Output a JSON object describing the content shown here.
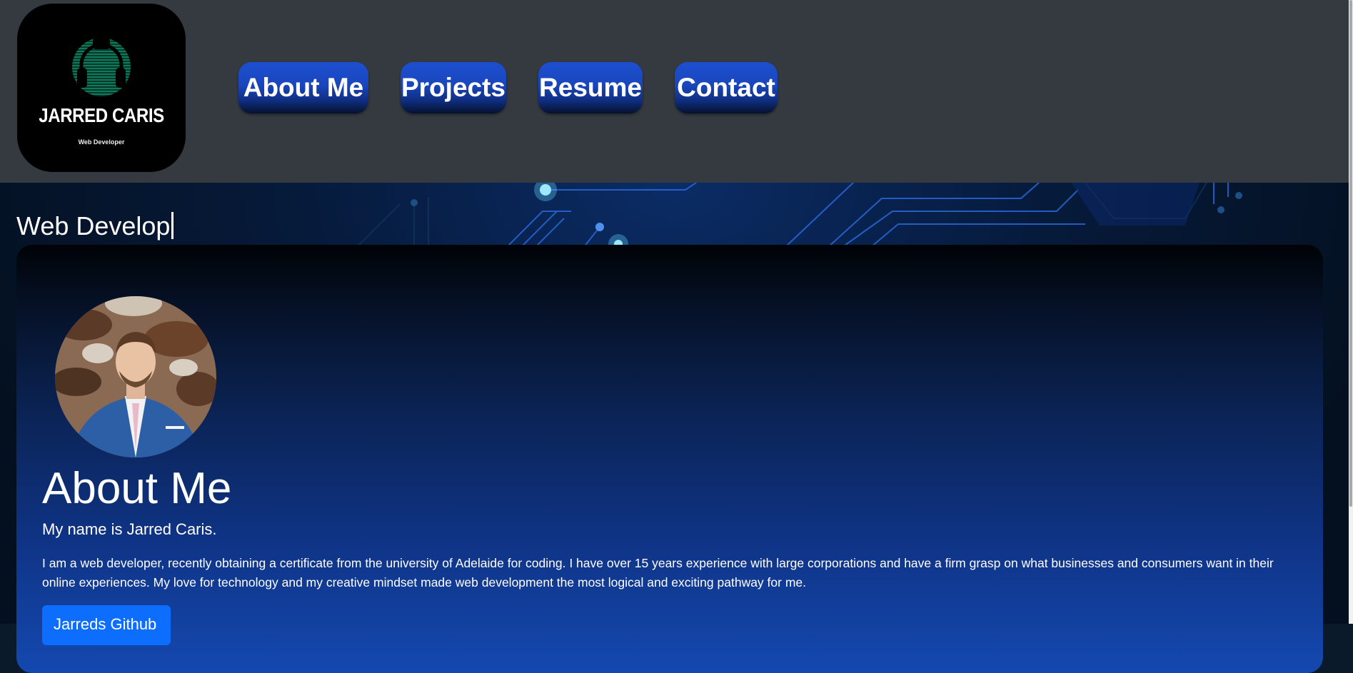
{
  "logo": {
    "name": "JARRED CARIS",
    "subtitle": "Web Developer",
    "accent_color": "#0e7a5c"
  },
  "nav": {
    "items": [
      {
        "label": "About Me"
      },
      {
        "label": "Projects"
      },
      {
        "label": "Resume"
      },
      {
        "label": "Contact"
      }
    ]
  },
  "hero": {
    "typed_text": "Web Develop"
  },
  "about": {
    "title": "About Me",
    "lead": "My name is Jarred Caris.",
    "body": "I am a web developer, recently obtaining a certificate from the university of Adelaide for coding. I have over 15 years experience with large corporations and have a firm grasp on what businesses and consumers want in their online experiences. My love for technology and my creative mindset made web development the most logical and exciting pathway for me.",
    "github_button": "Jarreds Github"
  },
  "colors": {
    "header_bg": "#343a40",
    "nav_button": "#1a46bd",
    "github_button": "#0d6efd"
  }
}
